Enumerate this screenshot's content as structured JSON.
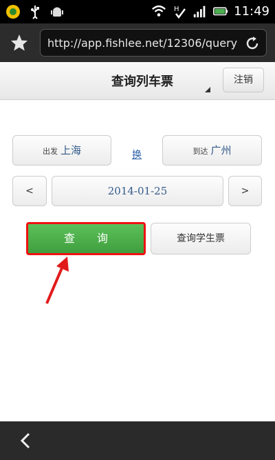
{
  "status_bar": {
    "time": "11:49",
    "icons": [
      "app-notification-icon",
      "usb-icon",
      "android-debug-icon",
      "wifi-icon",
      "sync-icon",
      "signal-icon",
      "battery-icon"
    ]
  },
  "browser": {
    "url": "http://app.fishlee.net/12306/query",
    "icons": [
      "bookmark-star-icon",
      "reload-icon"
    ]
  },
  "app_header": {
    "title": "查询列车票",
    "logout_label": "注销"
  },
  "stations": {
    "from_prefix": "出发",
    "from_city": "上海",
    "swap_label": "换",
    "to_prefix": "到达",
    "to_city": "广州"
  },
  "date_row": {
    "prev_label": "<",
    "date": "2014-01-25",
    "next_label": ">"
  },
  "actions": {
    "query_label": "查　　询",
    "student_label": "查询学生票"
  },
  "annotation": {
    "arrow_color": "#e11b1b"
  },
  "bottom_nav": {
    "icons": [
      "back-icon"
    ]
  }
}
